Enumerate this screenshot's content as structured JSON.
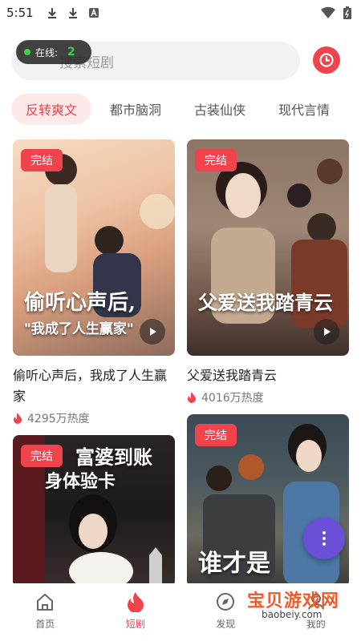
{
  "status_bar": {
    "time": "5:51"
  },
  "search": {
    "placeholder": "搜索短剧"
  },
  "online": {
    "label": "在线:",
    "count": "2"
  },
  "tabs": [
    {
      "label": "反转爽文",
      "active": true
    },
    {
      "label": "都市脑洞",
      "active": false
    },
    {
      "label": "古装仙侠",
      "active": false
    },
    {
      "label": "现代言情",
      "active": false
    }
  ],
  "cards": [
    {
      "badge": "完结",
      "poster_title": "偷听心声后,",
      "poster_subtitle": "\"我成了人生赢家\"",
      "title": "偷听心声后，我成了人生赢家",
      "heat": "4295万热度"
    },
    {
      "badge": "完结",
      "poster_title": "父爱送我踏青云",
      "title": "父爱送我踏青云",
      "heat": "4016万热度"
    },
    {
      "badge": "完结",
      "poster_title": "富婆到账",
      "poster_subtitle": "身体验卡",
      "title": "",
      "heat": ""
    },
    {
      "badge": "完结",
      "poster_title": "谁才是",
      "title": "",
      "heat": ""
    }
  ],
  "nav": [
    {
      "label": "首页",
      "active": false
    },
    {
      "label": "短剧",
      "active": true
    },
    {
      "label": "发现",
      "active": false
    },
    {
      "label": "我的",
      "active": false
    }
  ],
  "watermark": {
    "title": "宝贝游戏网",
    "url": "baobeiy.com"
  },
  "colors": {
    "accent": "#f0434b",
    "fab": "#6b4fd6"
  }
}
